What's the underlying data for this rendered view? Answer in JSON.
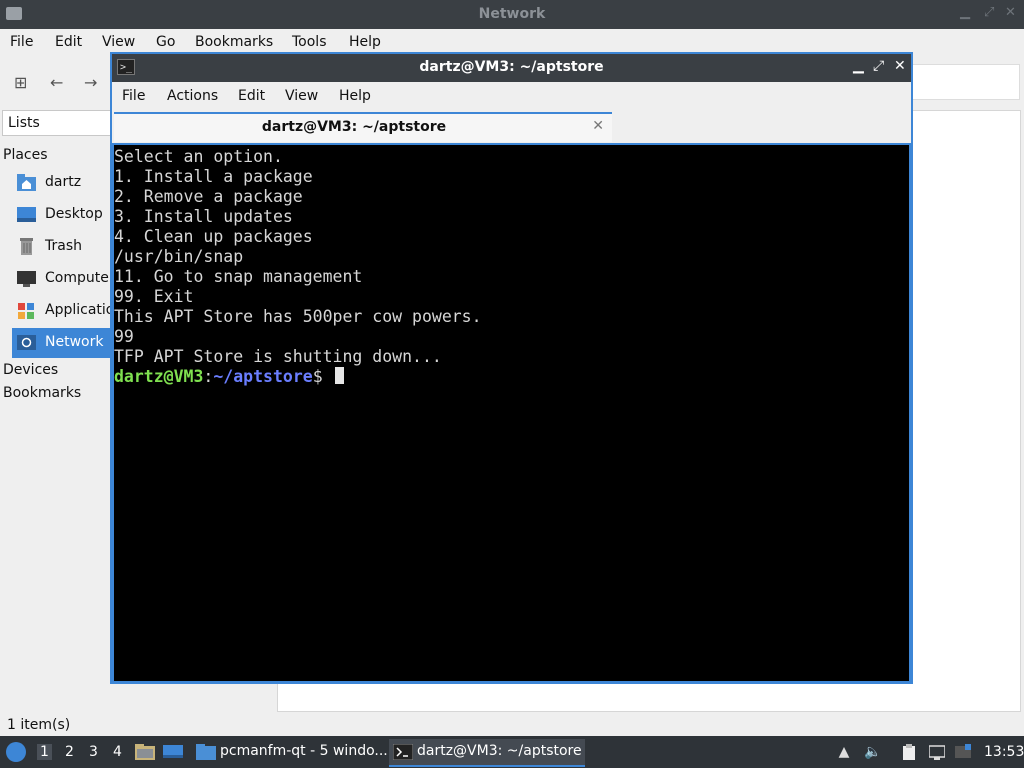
{
  "file_manager": {
    "title": "Network",
    "menu": [
      "File",
      "Edit",
      "View",
      "Go",
      "Bookmarks",
      "Tools",
      "Help"
    ],
    "side_pane_mode": "Lists",
    "sections": {
      "places": "Places",
      "devices": "Devices",
      "bookmarks": "Bookmarks"
    },
    "places": [
      {
        "label": "dartz",
        "icon": "home-folder-icon"
      },
      {
        "label": "Desktop",
        "icon": "desktop-icon"
      },
      {
        "label": "Trash",
        "icon": "trash-icon"
      },
      {
        "label": "Computer",
        "icon": "computer-icon"
      },
      {
        "label": "Applications",
        "icon": "applications-icon"
      },
      {
        "label": "Network",
        "icon": "network-icon",
        "selected": true
      }
    ],
    "status": "1 item(s)"
  },
  "terminal": {
    "title": "dartz@VM3: ~/aptstore",
    "menu": [
      "File",
      "Actions",
      "Edit",
      "View",
      "Help"
    ],
    "tab_label": "dartz@VM3: ~/aptstore",
    "output_lines": [
      "Select an option.",
      "1. Install a package",
      "2. Remove a package",
      "3. Install updates",
      "4. Clean up packages",
      "/usr/bin/snap",
      "11. Go to snap management",
      "99. Exit",
      "This APT Store has 500per cow powers.",
      "99",
      "TFP APT Store is shutting down..."
    ],
    "prompt": {
      "user_host": "dartz@VM3",
      "colon": ":",
      "path": "~/aptstore",
      "symbol": "$ "
    }
  },
  "taskbar": {
    "workspaces": [
      "1",
      "2",
      "3",
      "4"
    ],
    "tasks": [
      {
        "label": "pcmanfm-qt - 5 windo...",
        "icon": "folder-icon"
      },
      {
        "label": "dartz@VM3: ~/aptstore",
        "icon": "terminal-icon"
      }
    ],
    "clock": "13:53"
  },
  "colors": {
    "accent": "#3d86d6",
    "titlebar": "#3a3f44",
    "prompt_user": "#7fe050",
    "prompt_path": "#6a7eff"
  }
}
